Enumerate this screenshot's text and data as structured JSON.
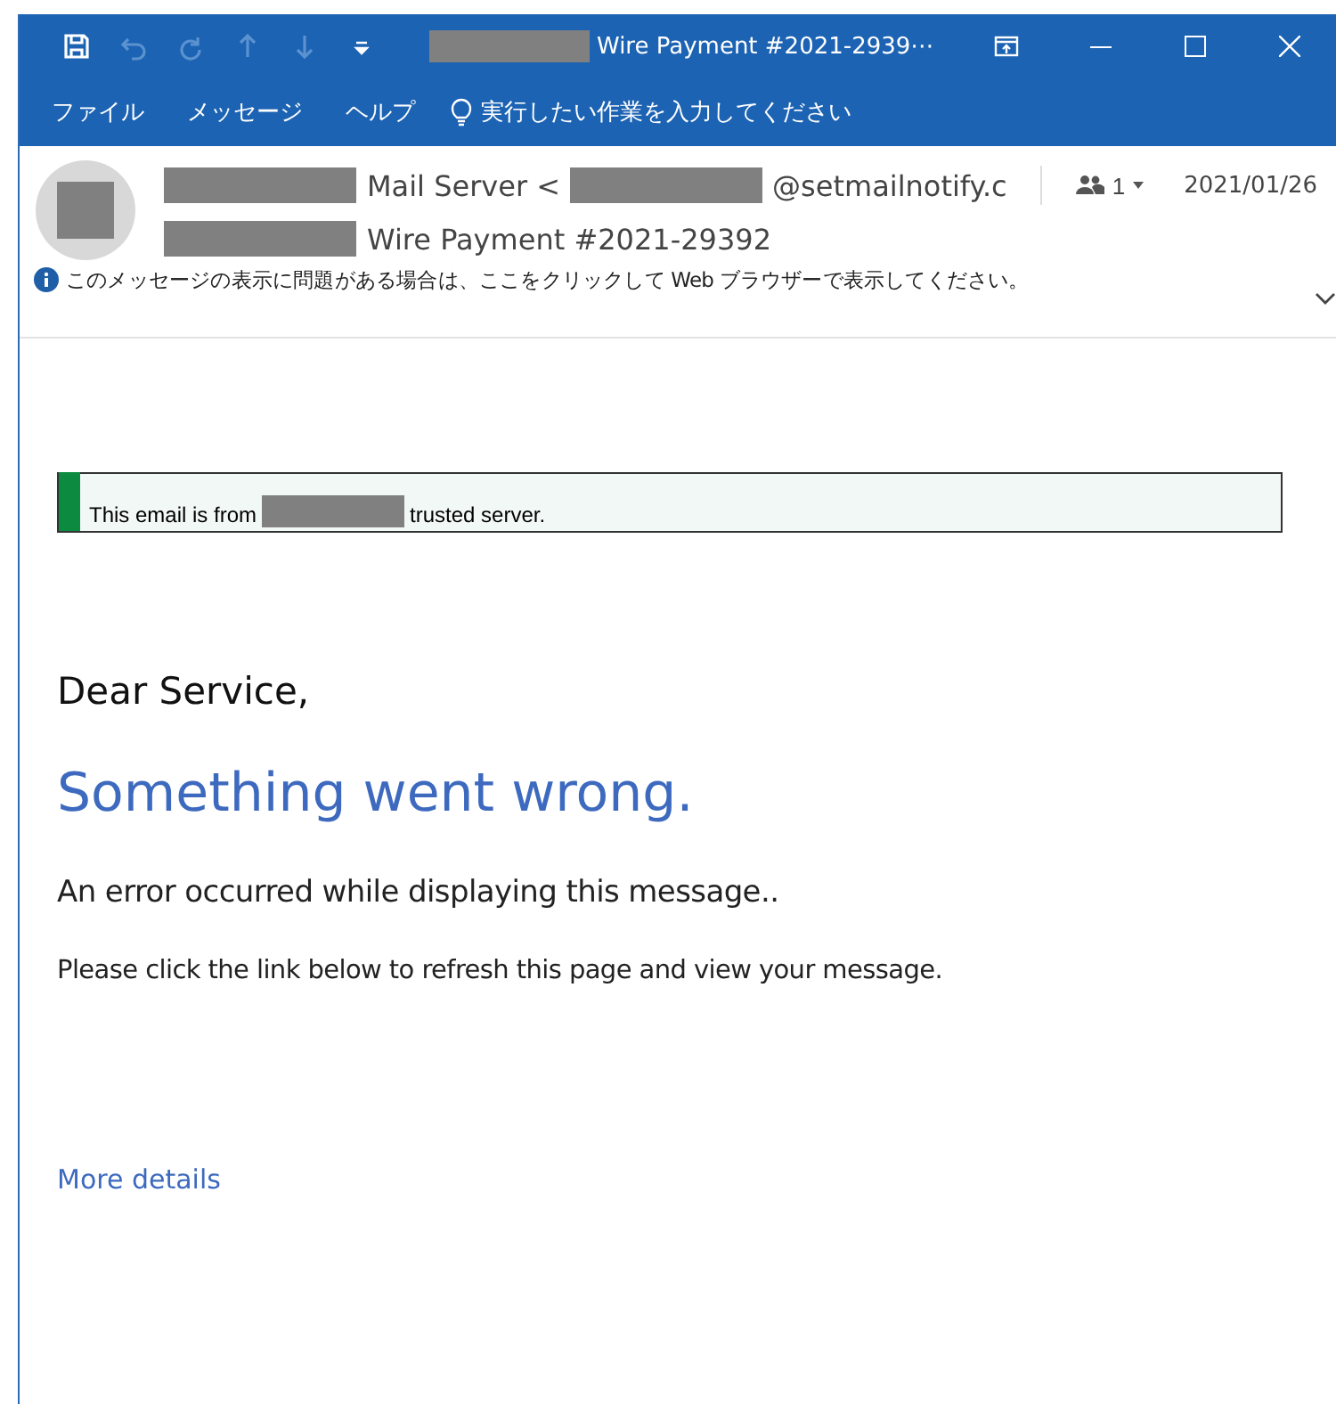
{
  "window": {
    "title": "Wire Payment #2021-2939⋯"
  },
  "quick_access": [
    {
      "kind": "save",
      "disabled": false
    },
    {
      "kind": "undo",
      "disabled": true
    },
    {
      "kind": "redo",
      "disabled": true
    },
    {
      "kind": "up",
      "disabled": true
    },
    {
      "kind": "down",
      "disabled": true
    },
    {
      "kind": "customize",
      "disabled": false
    }
  ],
  "menu": [
    {
      "label": "ファイル"
    },
    {
      "label": "メッセージ"
    },
    {
      "label": "ヘルプ"
    }
  ],
  "tell_me": {
    "placeholder": "実行したい作業を入力してください"
  },
  "header": {
    "sender": "Mail Server <",
    "sender_address": "@setmailnotify.c",
    "recipients_count": "1",
    "date": "2021/01/26",
    "subject": "Wire Payment #2021-29392",
    "info": "このメッセージの表示に問題がある場合は、ここをクリックして Web ブラウザーで表示してください。"
  },
  "banner": {
    "text_before": "This email is from",
    "text_after": "trusted server."
  },
  "body": {
    "greeting": "Dear Service,",
    "heading": "Something went wrong.",
    "error": "An error occurred while displaying this message..",
    "instruction": "Please click the link below to refresh this page and view your message.",
    "link": "More details"
  }
}
